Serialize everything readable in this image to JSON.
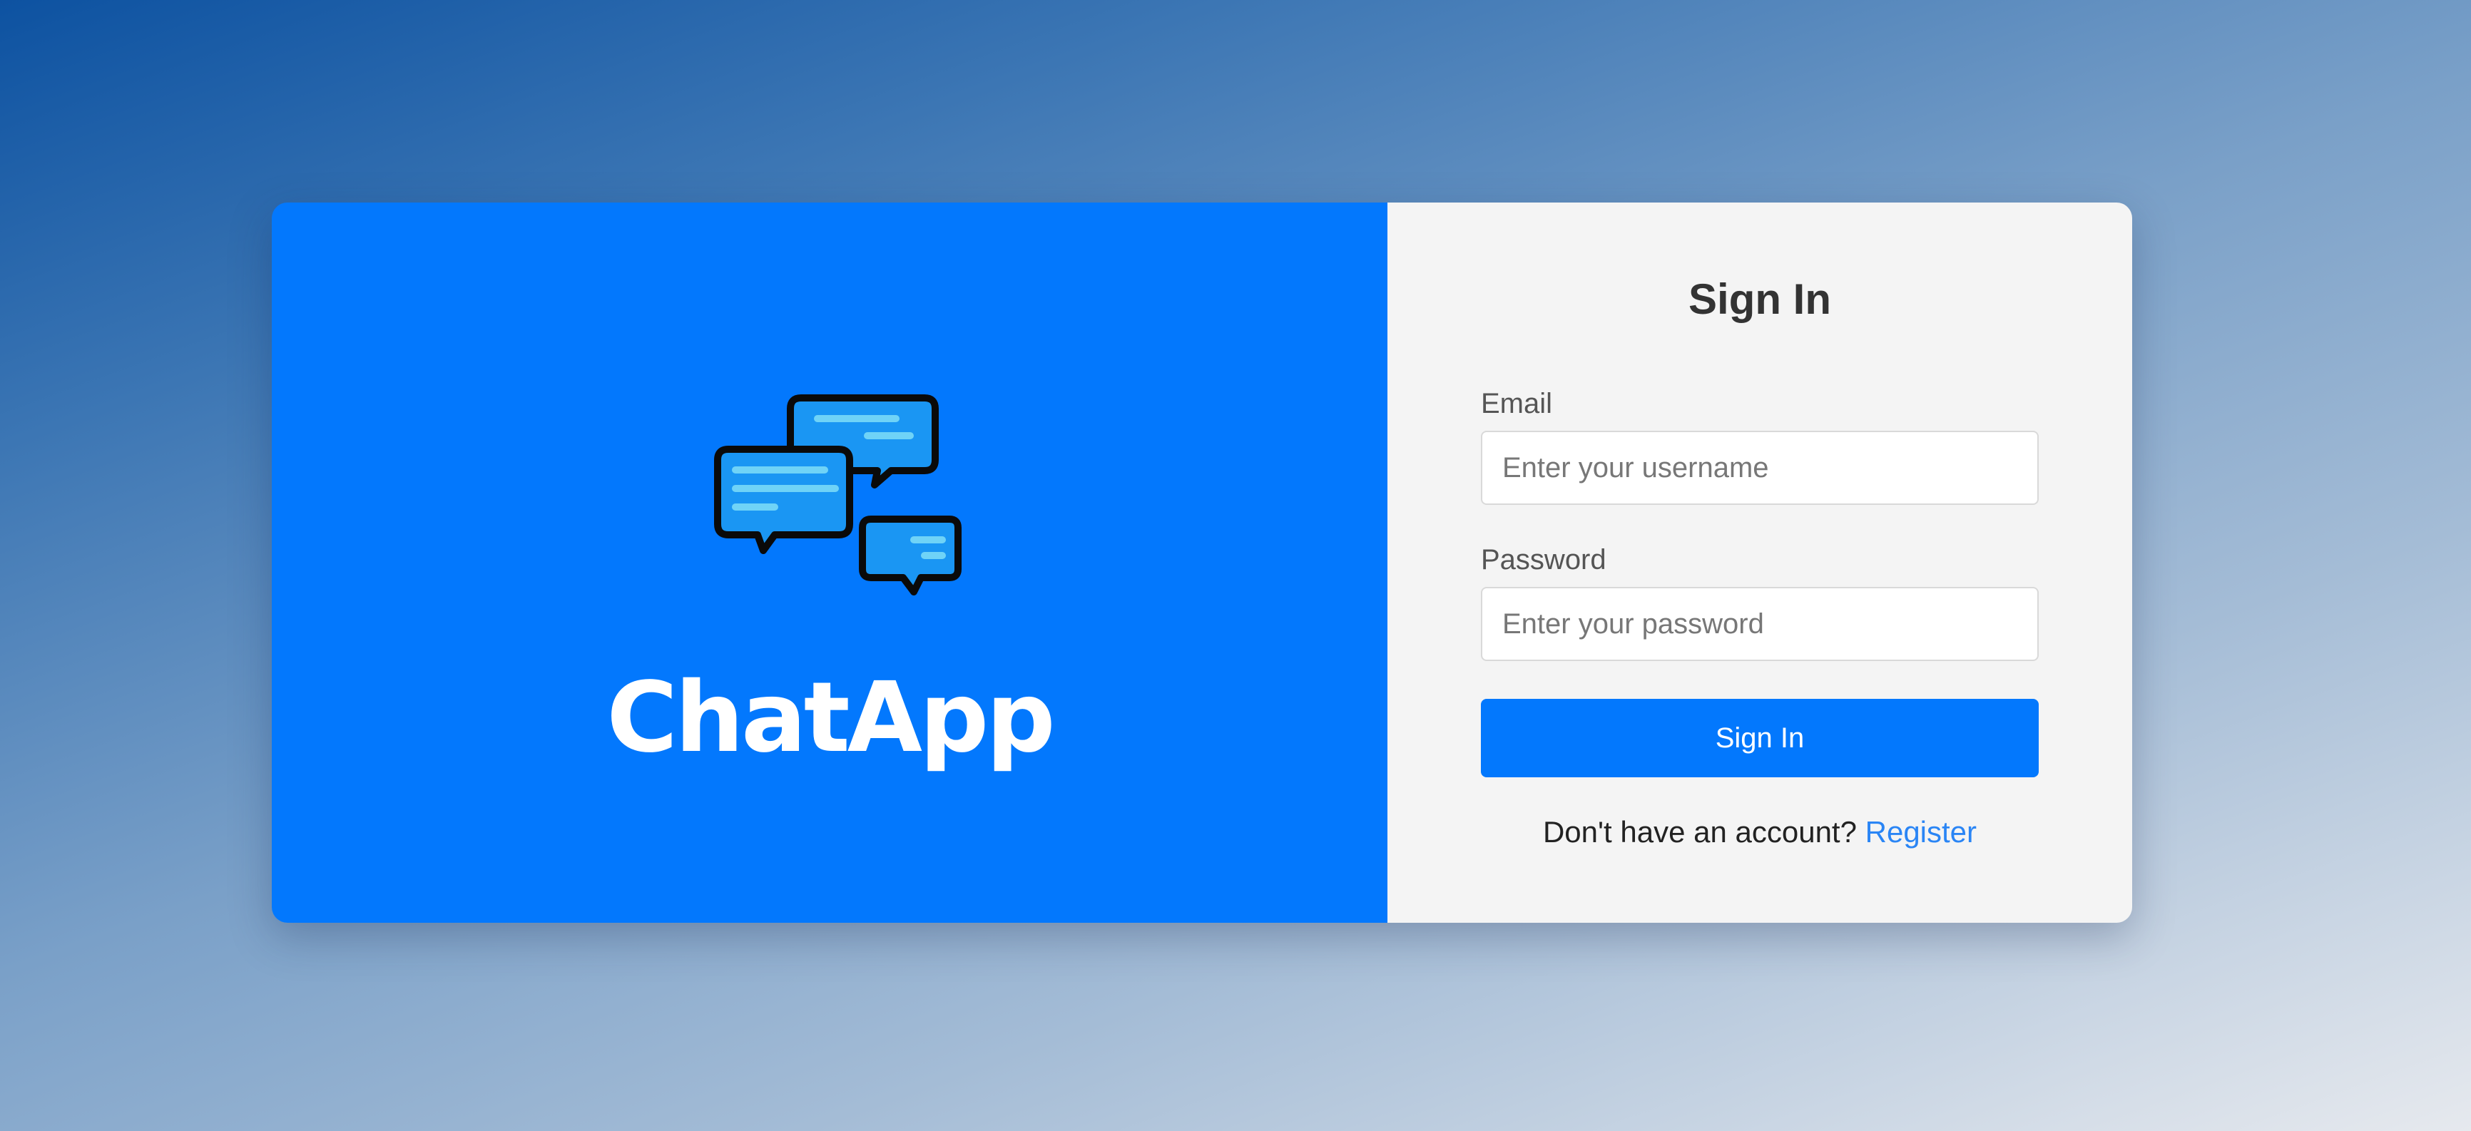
{
  "brand": {
    "name": "ChatApp",
    "logo_icon": "chat-bubbles-icon",
    "panel_color": "#0378fd"
  },
  "signin": {
    "title": "Sign In",
    "email_label": "Email",
    "email_placeholder": "Enter your username",
    "email_value": "",
    "password_label": "Password",
    "password_placeholder": "Enter your password",
    "password_value": "",
    "submit_label": "Sign In",
    "register_prompt": "Don't have an account?",
    "register_link": "Register"
  },
  "colors": {
    "accent": "#0378fd",
    "link": "#2a85f5",
    "form_background": "#f4f4f4"
  }
}
